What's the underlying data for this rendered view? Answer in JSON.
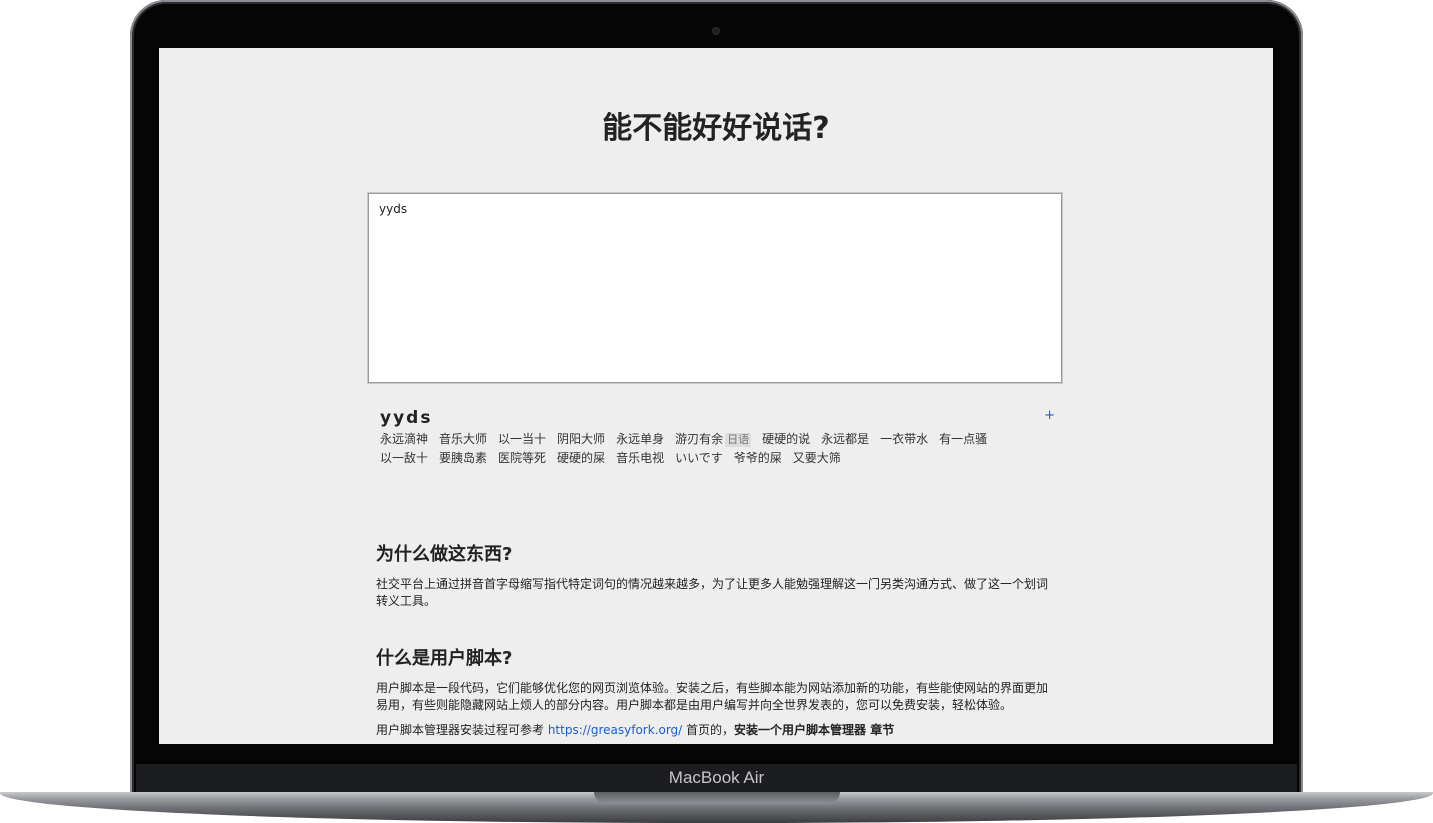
{
  "device": {
    "brand": "MacBook Air"
  },
  "page": {
    "title": "能不能好好说话?"
  },
  "input": {
    "value": "yyds"
  },
  "result": {
    "word": "yyds",
    "add_label": "+",
    "tags": [
      {
        "text": "永远滴神"
      },
      {
        "text": "音乐大师"
      },
      {
        "text": "以一当十"
      },
      {
        "text": "阴阳大师"
      },
      {
        "text": "永远单身"
      },
      {
        "text": "游刃有余",
        "note": "日语"
      },
      {
        "text": "硬硬的说"
      },
      {
        "text": "永远都是"
      },
      {
        "text": "一衣带水"
      },
      {
        "text": "有一点骚"
      },
      {
        "text": "以一敌十"
      },
      {
        "text": "要胰岛素"
      },
      {
        "text": "医院等死"
      },
      {
        "text": "硬硬的屎"
      },
      {
        "text": "音乐电视"
      },
      {
        "text": "いいです"
      },
      {
        "text": "爷爷的屎"
      },
      {
        "text": "又要大筛"
      }
    ]
  },
  "sections": {
    "why": {
      "heading": "为什么做这东西?",
      "body": "社交平台上通过拼音首字母缩写指代特定词句的情况越来越多，为了让更多人能勉强理解这一门另类沟通方式、做了这一个划词转义工具。"
    },
    "userscript": {
      "heading": "什么是用户脚本?",
      "body": "用户脚本是一段代码，它们能够优化您的网页浏览体验。安装之后，有些脚本能为网站添加新的功能，有些能使网站的界面更加易用，有些则能隐藏网站上烦人的部分内容。用户脚本都是由用户编写并向全世界发表的，您可以免费安装，轻松体验。",
      "install_prefix": "用户脚本管理器安装过程可参考 ",
      "install_link": "https://greasyfork.org/",
      "install_middle": " 首页的，",
      "install_bold": "安装一个用户脚本管理器",
      "install_suffix": " 章节"
    }
  }
}
